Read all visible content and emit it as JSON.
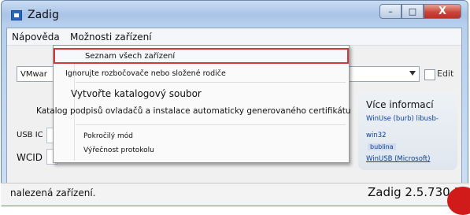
{
  "window": {
    "title": "Zadig",
    "buttons": {
      "minimize": "–",
      "maximize": "□",
      "close": "X"
    }
  },
  "menubar": {
    "help": "Nápověda",
    "options": "Možnosti zařízení"
  },
  "dropdown": {
    "items": [
      "Seznam všech zařízení",
      "Ignorujte rozbočovače nebo složené rodiče",
      "Vytvořte katalogový soubor",
      "Katalog podpisů ovladačů a instalace automaticky generovaného certifikátu",
      "Pokročilý mód",
      "Výřečnost protokolu"
    ]
  },
  "form": {
    "device_value": "VMwar",
    "edit_label": "Edit",
    "usb_label": "USB IC",
    "wcid_label": "WCID"
  },
  "info": {
    "title": "Více informací",
    "links": [
      "WinUse (burb) libusb-",
      "win32",
      "bublina",
      "WinUSB (Microsoft)"
    ]
  },
  "status": {
    "left": "nalezená zařízení.",
    "right": "Zadig 2.5.730 1"
  },
  "colors": {
    "highlight_border": "#d03a3a",
    "annotation_red": "#d11a1a"
  }
}
